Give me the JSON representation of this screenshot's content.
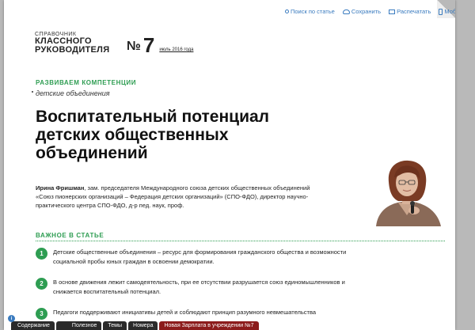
{
  "toolbar": {
    "search": "Поиск по статье",
    "save": "Сохранить",
    "print": "Распечатать",
    "mobile": "Мобильно"
  },
  "brand": {
    "small": "СПРАВОЧНИК",
    "line1": "КЛАССНОГО",
    "line2": "РУКОВОДИТЕЛЯ"
  },
  "issue": {
    "no": "№",
    "number": "7",
    "date": "июль 2016 года"
  },
  "article": {
    "section": "РАЗВИВАЕМ КОМПЕТЕНЦИИ",
    "subsection": "детские объединения",
    "title": "Воспитательный потенциал детских общественных объединений",
    "author_name": "Ирина Фришман",
    "author_desc": ", зам. председателя Международного союза детских общественных объединений «Союз пионерских организаций – Федерация детских организаций» (СПО-ФДО), директор научно-практического центра СПО-ФДО, д-р пед. наук, проф."
  },
  "important": {
    "heading": "ВАЖНОЕ В СТАТЬЕ",
    "items": [
      {
        "num": "1",
        "text": "Детские общественные объединения – ресурс для формирования гражданского общества и возможности социальной пробы юных граждан в освоении демократии."
      },
      {
        "num": "2",
        "text": "В основе движения лежит самодеятельность, при ее отсутствии разрушается союз единомышленников и снижается воспитательный потенциал."
      },
      {
        "num": "3",
        "text": "Педагоги поддерживают инициативы детей и соблюдают принцип разумного невмешательства"
      }
    ]
  },
  "bottom_bar": {
    "info": "i",
    "contents": "Содержание",
    "useful": "Полезное",
    "topics": "Темы",
    "issues": "Номера",
    "promo": "Новая Зарплата в учреждении №7"
  }
}
